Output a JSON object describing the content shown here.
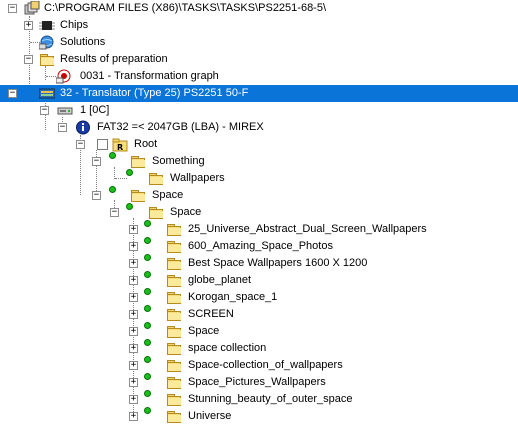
{
  "path_label": "C:\\PROGRAM FILES (X86)\\TASKS\\TASKS\\PS2251-68-5\\",
  "nodes": {
    "chips": "Chips",
    "solutions": "Solutions",
    "results": "Results of preparation",
    "graph": "0031 - Transformation graph",
    "translator": "32 - Translator  (Type 25) PS2251 50-F",
    "disk": "1 [0C]",
    "fat": "FAT32 =< 2047GB (LBA) - MIREX",
    "root": "Root",
    "something": "Something",
    "wallpapers": "Wallpapers",
    "space_outer": "Space",
    "space_inner": "Space"
  },
  "space_children": [
    "25_Universe_Abstract_Dual_Screen_Wallpapers",
    "600_Amazing_Space_Photos",
    "Best Space Wallpapers 1600 X 1200",
    "globe_planet",
    "Korogan_space_1",
    "SCREEN",
    "Space",
    "space collection",
    "Space-collection_of_wallpapers",
    "Space_Pictures_Wallpapers",
    "Stunning_beauty_of_outer_space",
    "Universe"
  ],
  "colors": {
    "selection": "#0a74d8",
    "folder": "#f7dd7c",
    "node_dot": "#18c018"
  }
}
